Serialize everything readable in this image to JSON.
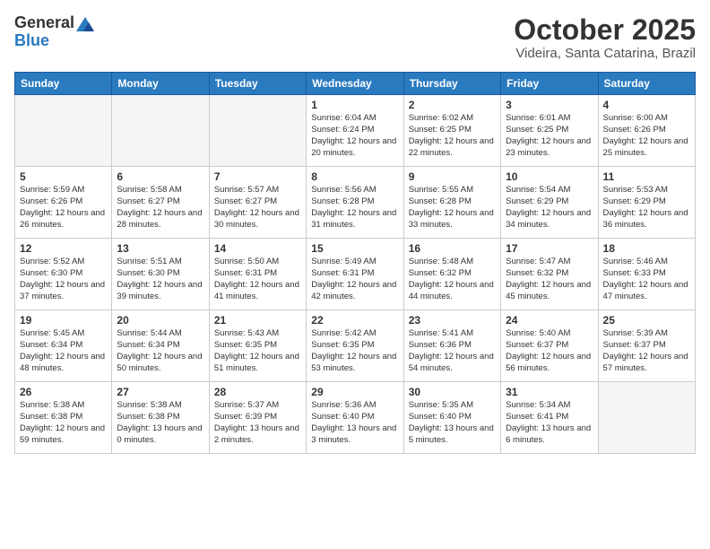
{
  "header": {
    "logo_general": "General",
    "logo_blue": "Blue",
    "month_title": "October 2025",
    "location": "Videira, Santa Catarina, Brazil"
  },
  "calendar": {
    "days_of_week": [
      "Sunday",
      "Monday",
      "Tuesday",
      "Wednesday",
      "Thursday",
      "Friday",
      "Saturday"
    ],
    "weeks": [
      [
        {
          "day": "",
          "info": ""
        },
        {
          "day": "",
          "info": ""
        },
        {
          "day": "",
          "info": ""
        },
        {
          "day": "1",
          "info": "Sunrise: 6:04 AM\nSunset: 6:24 PM\nDaylight: 12 hours\nand 20 minutes."
        },
        {
          "day": "2",
          "info": "Sunrise: 6:02 AM\nSunset: 6:25 PM\nDaylight: 12 hours\nand 22 minutes."
        },
        {
          "day": "3",
          "info": "Sunrise: 6:01 AM\nSunset: 6:25 PM\nDaylight: 12 hours\nand 23 minutes."
        },
        {
          "day": "4",
          "info": "Sunrise: 6:00 AM\nSunset: 6:26 PM\nDaylight: 12 hours\nand 25 minutes."
        }
      ],
      [
        {
          "day": "5",
          "info": "Sunrise: 5:59 AM\nSunset: 6:26 PM\nDaylight: 12 hours\nand 26 minutes."
        },
        {
          "day": "6",
          "info": "Sunrise: 5:58 AM\nSunset: 6:27 PM\nDaylight: 12 hours\nand 28 minutes."
        },
        {
          "day": "7",
          "info": "Sunrise: 5:57 AM\nSunset: 6:27 PM\nDaylight: 12 hours\nand 30 minutes."
        },
        {
          "day": "8",
          "info": "Sunrise: 5:56 AM\nSunset: 6:28 PM\nDaylight: 12 hours\nand 31 minutes."
        },
        {
          "day": "9",
          "info": "Sunrise: 5:55 AM\nSunset: 6:28 PM\nDaylight: 12 hours\nand 33 minutes."
        },
        {
          "day": "10",
          "info": "Sunrise: 5:54 AM\nSunset: 6:29 PM\nDaylight: 12 hours\nand 34 minutes."
        },
        {
          "day": "11",
          "info": "Sunrise: 5:53 AM\nSunset: 6:29 PM\nDaylight: 12 hours\nand 36 minutes."
        }
      ],
      [
        {
          "day": "12",
          "info": "Sunrise: 5:52 AM\nSunset: 6:30 PM\nDaylight: 12 hours\nand 37 minutes."
        },
        {
          "day": "13",
          "info": "Sunrise: 5:51 AM\nSunset: 6:30 PM\nDaylight: 12 hours\nand 39 minutes."
        },
        {
          "day": "14",
          "info": "Sunrise: 5:50 AM\nSunset: 6:31 PM\nDaylight: 12 hours\nand 41 minutes."
        },
        {
          "day": "15",
          "info": "Sunrise: 5:49 AM\nSunset: 6:31 PM\nDaylight: 12 hours\nand 42 minutes."
        },
        {
          "day": "16",
          "info": "Sunrise: 5:48 AM\nSunset: 6:32 PM\nDaylight: 12 hours\nand 44 minutes."
        },
        {
          "day": "17",
          "info": "Sunrise: 5:47 AM\nSunset: 6:32 PM\nDaylight: 12 hours\nand 45 minutes."
        },
        {
          "day": "18",
          "info": "Sunrise: 5:46 AM\nSunset: 6:33 PM\nDaylight: 12 hours\nand 47 minutes."
        }
      ],
      [
        {
          "day": "19",
          "info": "Sunrise: 5:45 AM\nSunset: 6:34 PM\nDaylight: 12 hours\nand 48 minutes."
        },
        {
          "day": "20",
          "info": "Sunrise: 5:44 AM\nSunset: 6:34 PM\nDaylight: 12 hours\nand 50 minutes."
        },
        {
          "day": "21",
          "info": "Sunrise: 5:43 AM\nSunset: 6:35 PM\nDaylight: 12 hours\nand 51 minutes."
        },
        {
          "day": "22",
          "info": "Sunrise: 5:42 AM\nSunset: 6:35 PM\nDaylight: 12 hours\nand 53 minutes."
        },
        {
          "day": "23",
          "info": "Sunrise: 5:41 AM\nSunset: 6:36 PM\nDaylight: 12 hours\nand 54 minutes."
        },
        {
          "day": "24",
          "info": "Sunrise: 5:40 AM\nSunset: 6:37 PM\nDaylight: 12 hours\nand 56 minutes."
        },
        {
          "day": "25",
          "info": "Sunrise: 5:39 AM\nSunset: 6:37 PM\nDaylight: 12 hours\nand 57 minutes."
        }
      ],
      [
        {
          "day": "26",
          "info": "Sunrise: 5:38 AM\nSunset: 6:38 PM\nDaylight: 12 hours\nand 59 minutes."
        },
        {
          "day": "27",
          "info": "Sunrise: 5:38 AM\nSunset: 6:38 PM\nDaylight: 13 hours\nand 0 minutes."
        },
        {
          "day": "28",
          "info": "Sunrise: 5:37 AM\nSunset: 6:39 PM\nDaylight: 13 hours\nand 2 minutes."
        },
        {
          "day": "29",
          "info": "Sunrise: 5:36 AM\nSunset: 6:40 PM\nDaylight: 13 hours\nand 3 minutes."
        },
        {
          "day": "30",
          "info": "Sunrise: 5:35 AM\nSunset: 6:40 PM\nDaylight: 13 hours\nand 5 minutes."
        },
        {
          "day": "31",
          "info": "Sunrise: 5:34 AM\nSunset: 6:41 PM\nDaylight: 13 hours\nand 6 minutes."
        },
        {
          "day": "",
          "info": ""
        }
      ]
    ]
  }
}
